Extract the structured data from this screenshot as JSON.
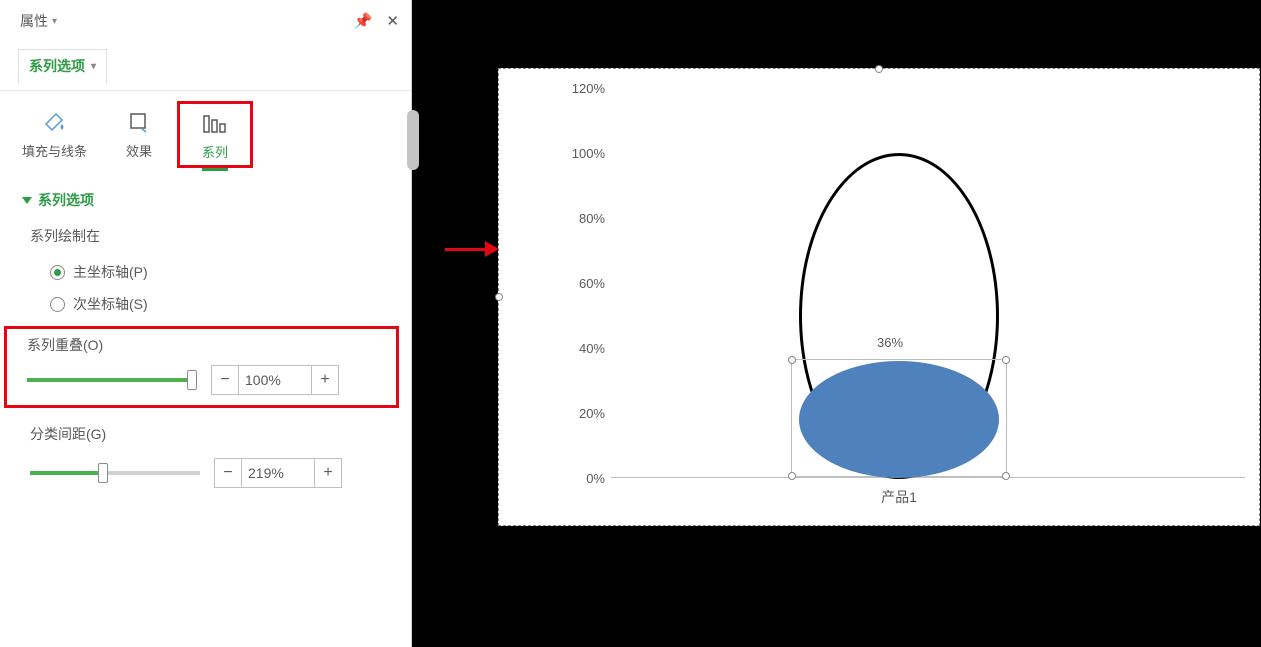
{
  "panel": {
    "title": "属性",
    "dropdown": "系列选项",
    "tabs": [
      {
        "key": "fill",
        "label": "填充与线条"
      },
      {
        "key": "effect",
        "label": "效果"
      },
      {
        "key": "series",
        "label": "系列",
        "active": true
      }
    ]
  },
  "section": {
    "header": "系列选项",
    "plot_on_label": "系列绘制在",
    "radios": [
      {
        "key": "primary",
        "label": "主坐标轴(P)",
        "selected": true
      },
      {
        "key": "secondary",
        "label": "次坐标轴(S)",
        "selected": false
      }
    ],
    "overlap": {
      "label": "系列重叠(O)",
      "value": "100%"
    },
    "gap": {
      "label": "分类间距(G)",
      "value": "219%"
    }
  },
  "chart_data": {
    "type": "bar",
    "categories": [
      "产品1"
    ],
    "series": [
      {
        "name": "outline",
        "values": [
          100
        ]
      },
      {
        "name": "fill",
        "values": [
          36
        ]
      }
    ],
    "data_label": "36%",
    "ylabel": "",
    "xlabel": "",
    "ylim": [
      0,
      120
    ],
    "yticks": [
      "0%",
      "20%",
      "40%",
      "60%",
      "80%",
      "100%",
      "120%"
    ]
  }
}
